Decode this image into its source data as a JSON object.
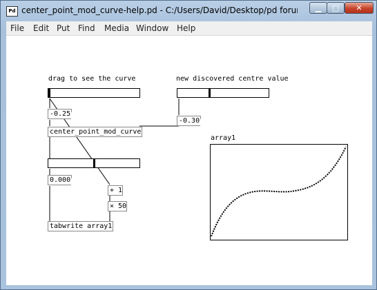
{
  "window": {
    "title": "center_point_mod_curve-help.pd  - C:/Users/David/Desktop/pd forum/cen...",
    "app_icon": "Pd",
    "buttons": {
      "minimize": "▁",
      "maximize": "□",
      "close": "✕"
    }
  },
  "menu": [
    "File",
    "Edit",
    "Put",
    "Find",
    "Media",
    "Window",
    "Help"
  ],
  "canvas": {
    "comment_drag": "drag to see the curve",
    "comment_centre": "new discovered centre value",
    "number_top": "-0.25",
    "number_centre": "-0.30",
    "number_mid": "0.000",
    "object_curve": "center_point_mod_curve",
    "object_add": "+ 1",
    "object_mul": "× 50",
    "object_tabwrite": "tabwrite array1",
    "array_label": "array1",
    "slider_top_value": 0.0,
    "slider_centre_value": 0.35,
    "slider_mid_value": 0.5
  }
}
